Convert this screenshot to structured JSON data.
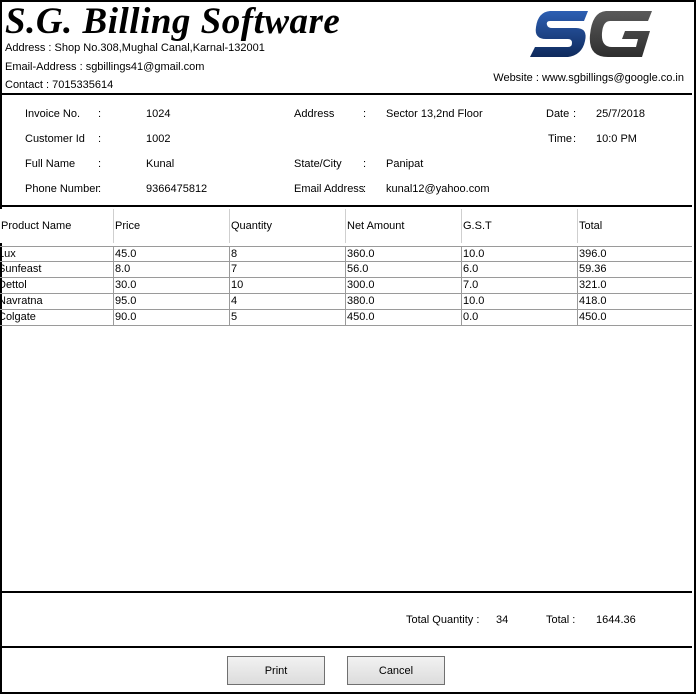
{
  "header": {
    "title": "S.G. Billing Software",
    "address_line": "Address : Shop No.308,Mughal Canal,Karnal-132001",
    "email_line": "Email-Address :  sgbillings41@gmail.com",
    "contact_line": "Contact : 7015335614",
    "website_line": "Website : www.sgbillings@google.co.in",
    "logo_text": "SG",
    "logo_colors": {
      "s": "#1a3d7c",
      "g": "#4a4a4a"
    }
  },
  "invoice": {
    "invoice_no_label": "Invoice No.",
    "invoice_no": "1024",
    "customer_id_label": "Customer Id",
    "customer_id": "1002",
    "full_name_label": "Full Name",
    "full_name": "Kunal",
    "phone_label": "Phone Number",
    "phone": "9366475812",
    "address_label": "Address",
    "address": "Sector 13,2nd Floor",
    "state_city_label": "State/City",
    "state_city": "Panipat",
    "email_label": "Email Address",
    "email": "kunal12@yahoo.com",
    "date_label": "Date",
    "date": "25/7/2018",
    "time_label": "Time",
    "time": "10:0 PM",
    "colon": ":"
  },
  "table": {
    "columns": [
      "Product Name",
      "Price",
      "Quantity",
      "Net Amount",
      "G.S.T",
      "Total"
    ],
    "rows": [
      [
        "Lux",
        "45.0",
        "8",
        "360.0",
        "10.0",
        "396.0"
      ],
      [
        "Sunfeast",
        "8.0",
        "7",
        "56.0",
        "6.0",
        "59.36"
      ],
      [
        "Dettol",
        "30.0",
        "10",
        "300.0",
        "7.0",
        "321.0"
      ],
      [
        "Navratna",
        "95.0",
        "4",
        "380.0",
        "10.0",
        "418.0"
      ],
      [
        "Colgate",
        "90.0",
        "5",
        "450.0",
        "0.0",
        "450.0"
      ]
    ]
  },
  "totals": {
    "quantity_label": "Total Quantity :",
    "quantity": "34",
    "total_label": "Total :",
    "total": "1644.36"
  },
  "buttons": {
    "print": "Print",
    "cancel": "Cancel"
  }
}
